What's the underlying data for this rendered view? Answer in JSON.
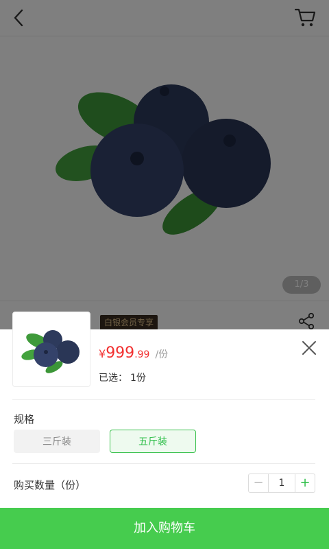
{
  "gallery": {
    "counter": "1/3"
  },
  "product": {
    "member_badge": "白银会员专享"
  },
  "sheet": {
    "price_currency": "¥",
    "price_integer": "999",
    "price_decimal": ".99",
    "price_unit": "/份",
    "selected_label": "已选：",
    "selected_value": "1份",
    "spec_label": "规格",
    "options": [
      {
        "label": "三斤装",
        "selected": false
      },
      {
        "label": "五斤装",
        "selected": true
      }
    ],
    "quantity_label": "购买数量（份）",
    "quantity_value": "1",
    "minus_symbol": "−",
    "plus_symbol": "+",
    "add_to_cart_label": "加入购物车"
  },
  "colors": {
    "accent_green": "#46cc4e",
    "price_red": "#f23030",
    "badge_bg": "#3a2d20",
    "badge_text": "#e2c38d"
  },
  "icons": {
    "back": "chevron-left-icon",
    "cart": "shopping-cart-icon",
    "share": "share-icon",
    "close": "close-icon"
  }
}
